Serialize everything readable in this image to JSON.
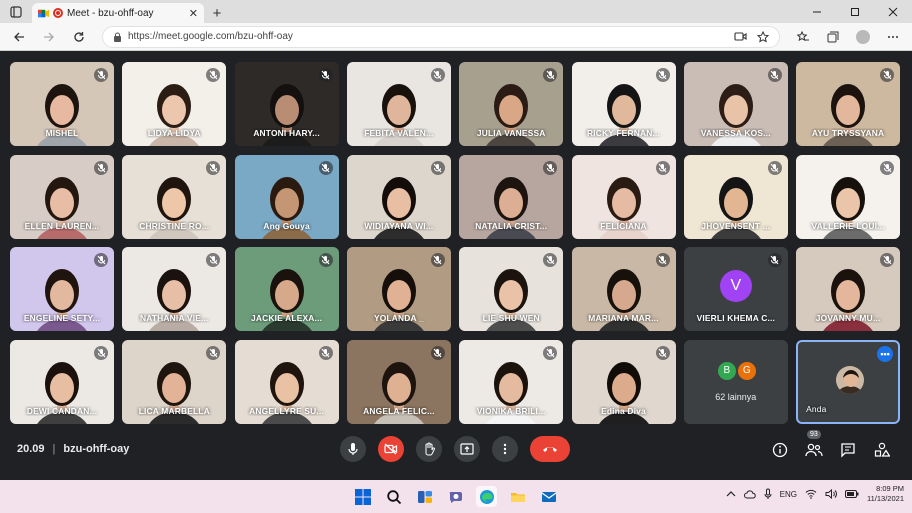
{
  "browser": {
    "tab_title": "Meet - bzu-ohff-oay",
    "tab_close": "✕",
    "new_tab": "+",
    "url": "https://meet.google.com/bzu-ohff-oay"
  },
  "participants": [
    {
      "name": "MISHEL",
      "bg": "#d5c7b8",
      "shirt": "#a0a4ab",
      "hair": "#1d1410",
      "skin": "#e6b9a0"
    },
    {
      "name": "LIDYA LIDYA",
      "bg": "#f3efe9",
      "shirt": "#c9b6a8",
      "hair": "#2b1d14",
      "skin": "#ecc6ad"
    },
    {
      "name": "ANTONI HARY...",
      "bg": "#2e2a28",
      "shirt": "#1c1c1c",
      "hair": "#141010",
      "skin": "#b88d73"
    },
    {
      "name": "FEBITA VALEN...",
      "bg": "#e9e6e2",
      "shirt": "#d7d2cd",
      "hair": "#18110c",
      "skin": "#dfb59c"
    },
    {
      "name": "JULIA VANESSA",
      "bg": "#a7a08f",
      "shirt": "#4d4640",
      "hair": "#2a1c14",
      "skin": "#d9a786"
    },
    {
      "name": "RICKY FERNAN...",
      "bg": "#f2efea",
      "shirt": "#3c3c40",
      "hair": "#141414",
      "skin": "#e0b89b"
    },
    {
      "name": "VANESSA KOS...",
      "bg": "#c9bdb6",
      "shirt": "#eeeeee",
      "hair": "#2c1e17",
      "skin": "#e8c3a8"
    },
    {
      "name": "AYU TRYSSYANA",
      "bg": "#cdb9a0",
      "shirt": "#6d6155",
      "hair": "#1c130e",
      "skin": "#e3b79c"
    },
    {
      "name": "ELLEN LAUREN...",
      "bg": "#d8cdc6",
      "shirt": "#b86b6b",
      "hair": "#24170f",
      "skin": "#e7bda5"
    },
    {
      "name": "CHRISTINE RO...",
      "bg": "#e7e0d6",
      "shirt": "#d0c8be",
      "hair": "#20150e",
      "skin": "#eec6a8"
    },
    {
      "name": "Ang Gouya",
      "bg": "#7aa9c6",
      "shirt": "#8a6b4a",
      "hair": "#2a1a10",
      "skin": "#c59673"
    },
    {
      "name": "WIDIAYANA WI...",
      "bg": "#ddd6cd",
      "shirt": "#2d2d2d",
      "hair": "#130d09",
      "skin": "#e9bfa4"
    },
    {
      "name": "NATALIA CRIST...",
      "bg": "#b7a6a0",
      "shirt": "#4a4a52",
      "hair": "#1d140f",
      "skin": "#dcae93"
    },
    {
      "name": "FELICIANA",
      "bg": "#efe4e0",
      "shirt": "#e7d3cc",
      "hair": "#2a1b13",
      "skin": "#e5bba3"
    },
    {
      "name": "JHOVENSENT ...",
      "bg": "#efe6d4",
      "shirt": "#3b3b3b",
      "hair": "#141414",
      "skin": "#e2b693"
    },
    {
      "name": "VALLERIE LOUI...",
      "bg": "#f5f2ee",
      "shirt": "#6b6b6b",
      "hair": "#17110c",
      "skin": "#ebc5aa"
    },
    {
      "name": "ENGELINE SETY...",
      "bg": "#d1c6ec",
      "shirt": "#7a5a8e",
      "hair": "#1f140e",
      "skin": "#e2b89f"
    },
    {
      "name": "NATHANIA VIE...",
      "bg": "#ece8e3",
      "shirt": "#b8aca4",
      "hair": "#1b120d",
      "skin": "#e6bfa6"
    },
    {
      "name": "JACKIE ALEXA...",
      "bg": "#6d9c7b",
      "shirt": "#2a3a2e",
      "hair": "#1a120d",
      "skin": "#d7a98b"
    },
    {
      "name": "YOLANDA _",
      "bg": "#b19c83",
      "shirt": "#3a3a3a",
      "hair": "#150e0a",
      "skin": "#e0b193"
    },
    {
      "name": "LIE SHU WEN",
      "bg": "#e7e2dc",
      "shirt": "#4e4e4e",
      "hair": "#1c130e",
      "skin": "#e9c2a7"
    },
    {
      "name": "MARIANA MAR...",
      "bg": "#c8b8a5",
      "shirt": "#303030",
      "hair": "#17100b",
      "skin": "#d6a98e"
    },
    {
      "name": "VIERLI KHEMA C...",
      "bg": "",
      "initial": "V"
    },
    {
      "name": "JOVANNY MU...",
      "bg": "#d6c9bd",
      "shirt": "#8a2f3c",
      "hair": "#1b120d",
      "skin": "#e4b79c"
    },
    {
      "name": "DEWI CANDAN...",
      "bg": "#ece9e5",
      "shirt": "#3f3f3f",
      "hair": "#1a110c",
      "skin": "#e8bea3"
    },
    {
      "name": "LICA MARBELLA",
      "bg": "#ddd4ca",
      "shirt": "#2b2b2b",
      "hair": "#1f150f",
      "skin": "#e2b396"
    },
    {
      "name": "ANGELLYRE SU...",
      "bg": "#e5ddd3",
      "shirt": "#4b4b4b",
      "hair": "#20150e",
      "skin": "#e9c1a3"
    },
    {
      "name": "ANGELA FELIC...",
      "bg": "#8c7560",
      "shirt": "#c6c0b6",
      "hair": "#1e140e",
      "skin": "#dfb193"
    },
    {
      "name": "VIONIKA BRILI...",
      "bg": "#ede9e4",
      "shirt": "#f4f4f4",
      "hair": "#1b120c",
      "skin": "#e5bba0"
    },
    {
      "name": "Edina Diva",
      "bg": "#e0d8cf",
      "shirt": "#1f1f1f",
      "hair": "#120c08",
      "skin": "#dcab8c"
    }
  ],
  "others": {
    "avatars": [
      {
        "letter": "B",
        "color": "#33a852"
      },
      {
        "letter": "G",
        "color": "#e8710a"
      }
    ],
    "label": "62 lainnya"
  },
  "self": {
    "name": "Anda",
    "more": "•••"
  },
  "meeting": {
    "time": "20.09",
    "separator": "|",
    "code": "bzu-ohff-oay",
    "people_count": "93"
  },
  "taskbar": {
    "language": "ENG",
    "time": "8:09 PM",
    "date": "11/13/2021"
  },
  "colors": {
    "end_call": "#ea4335",
    "self_border": "#8ab4f8",
    "avatar_v": "#a142f4"
  }
}
